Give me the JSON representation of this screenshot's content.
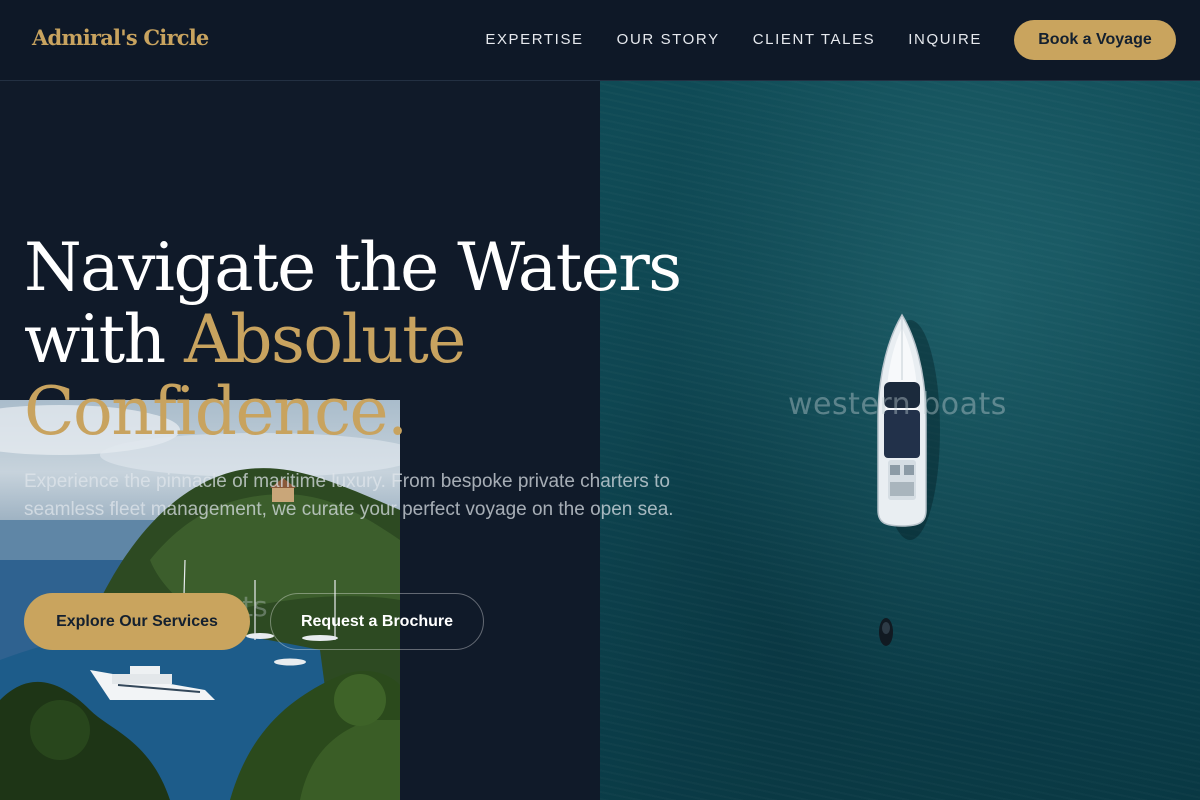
{
  "brand": {
    "logo_text": "Admiral's Circle",
    "accent_color": "#c8a35f",
    "background_color": "#101a29"
  },
  "nav": {
    "links": [
      "EXPERTISE",
      "OUR STORY",
      "CLIENT TALES",
      "INQUIRE"
    ],
    "cta_label": "Book a Voyage"
  },
  "hero": {
    "headline_line1": "Navigate the Waters",
    "headline_with": "with ",
    "headline_accent_1": "Absolute",
    "headline_accent_2": "Confidence.",
    "subtext": "Experience the pinnacle of maritime luxury. From bespoke private charters to seamless fleet management, we curate your perfect voyage on the open sea.",
    "primary_cta": "Explore Our Services",
    "secondary_cta": "Request a Brochure"
  },
  "images": {
    "sea_watermark": "western boats",
    "coast_watermark": "boats"
  }
}
